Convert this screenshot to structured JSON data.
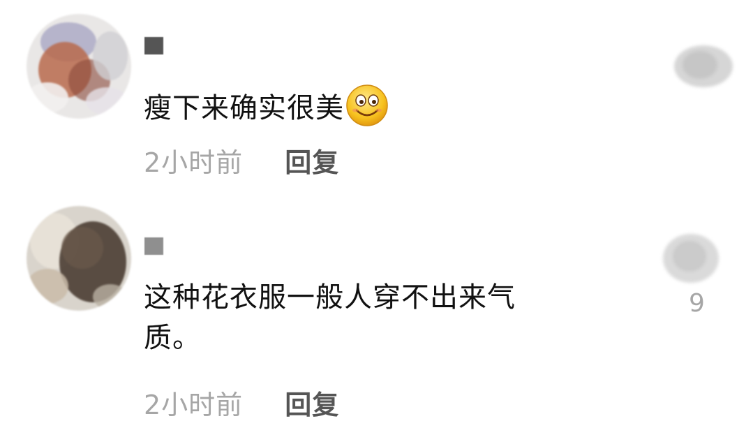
{
  "comments": [
    {
      "text": "瘦下来确实很美",
      "emoji": "smiling-face-emoji",
      "timestamp": "2小时前",
      "reply_label": "回复",
      "like_count": ""
    },
    {
      "text_line1": "这种花衣服一般人穿不出来气",
      "text_line2": "质。",
      "timestamp": "2小时前",
      "reply_label": "回复",
      "like_count": "9"
    }
  ],
  "colors": {
    "text": "#111111",
    "meta": "#a6a6a6",
    "reply": "#555555",
    "background": "#ffffff"
  }
}
